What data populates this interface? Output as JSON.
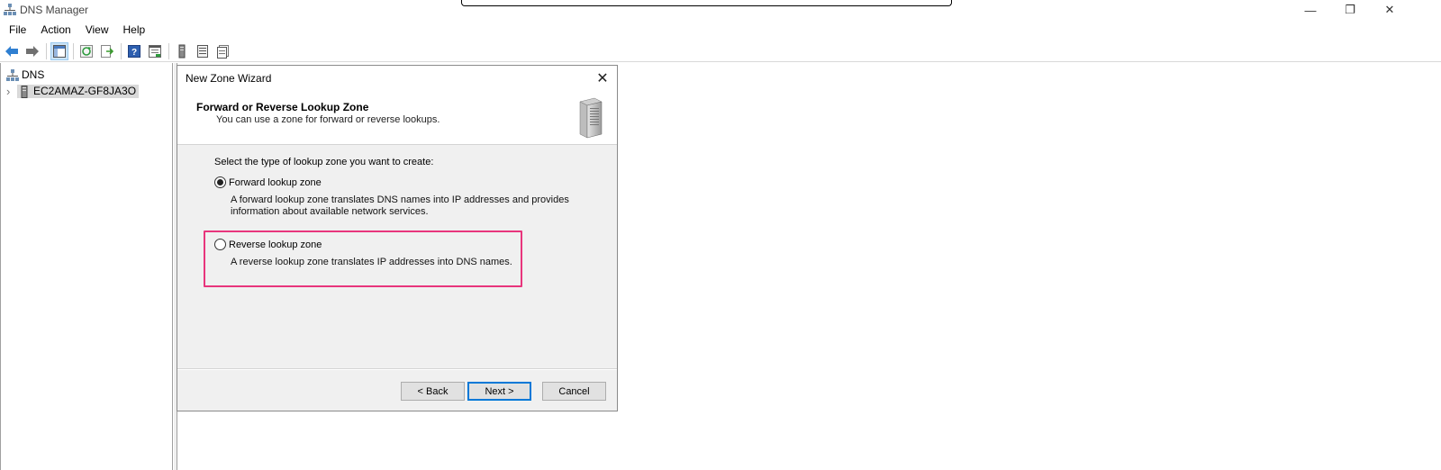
{
  "window": {
    "title": "DNS Manager",
    "controls": {
      "minimize": "—",
      "restore": "❐",
      "close": "✕"
    }
  },
  "menu": [
    "File",
    "Action",
    "View",
    "Help"
  ],
  "toolbar": {
    "icons": [
      "back-arrow-icon",
      "forward-arrow-icon",
      "show-hide-console-tree-icon",
      "refresh-icon",
      "export-list-icon",
      "help-icon",
      "properties-icon",
      "server-icon",
      "list-icon",
      "filter-icon"
    ]
  },
  "tree": {
    "root": "DNS",
    "server": "EC2AMAZ-GF8JA3O",
    "expander": "›"
  },
  "dialog": {
    "title": "New Zone Wizard",
    "close_glyph": "✕",
    "heading": "Forward or Reverse Lookup Zone",
    "subheading": "You can use a zone for forward or reverse lookups.",
    "prompt": "Select the type of lookup zone you want to create:",
    "options": [
      {
        "label": "Forward lookup zone",
        "selected": true,
        "description_lines": [
          "A forward lookup zone translates DNS names into IP addresses and provides",
          "information about available network services."
        ]
      },
      {
        "label": "Reverse lookup zone",
        "selected": false,
        "description_lines": [
          "A reverse lookup zone translates IP addresses into DNS names."
        ]
      }
    ],
    "buttons": {
      "back": "< Back",
      "next": "Next >",
      "cancel": "Cancel"
    },
    "highlight_color": "#e8357c"
  },
  "colors": {
    "accent": "#0078d7",
    "dialog_bg": "#f0f0f0",
    "selection_bg": "#d9d9d9"
  }
}
